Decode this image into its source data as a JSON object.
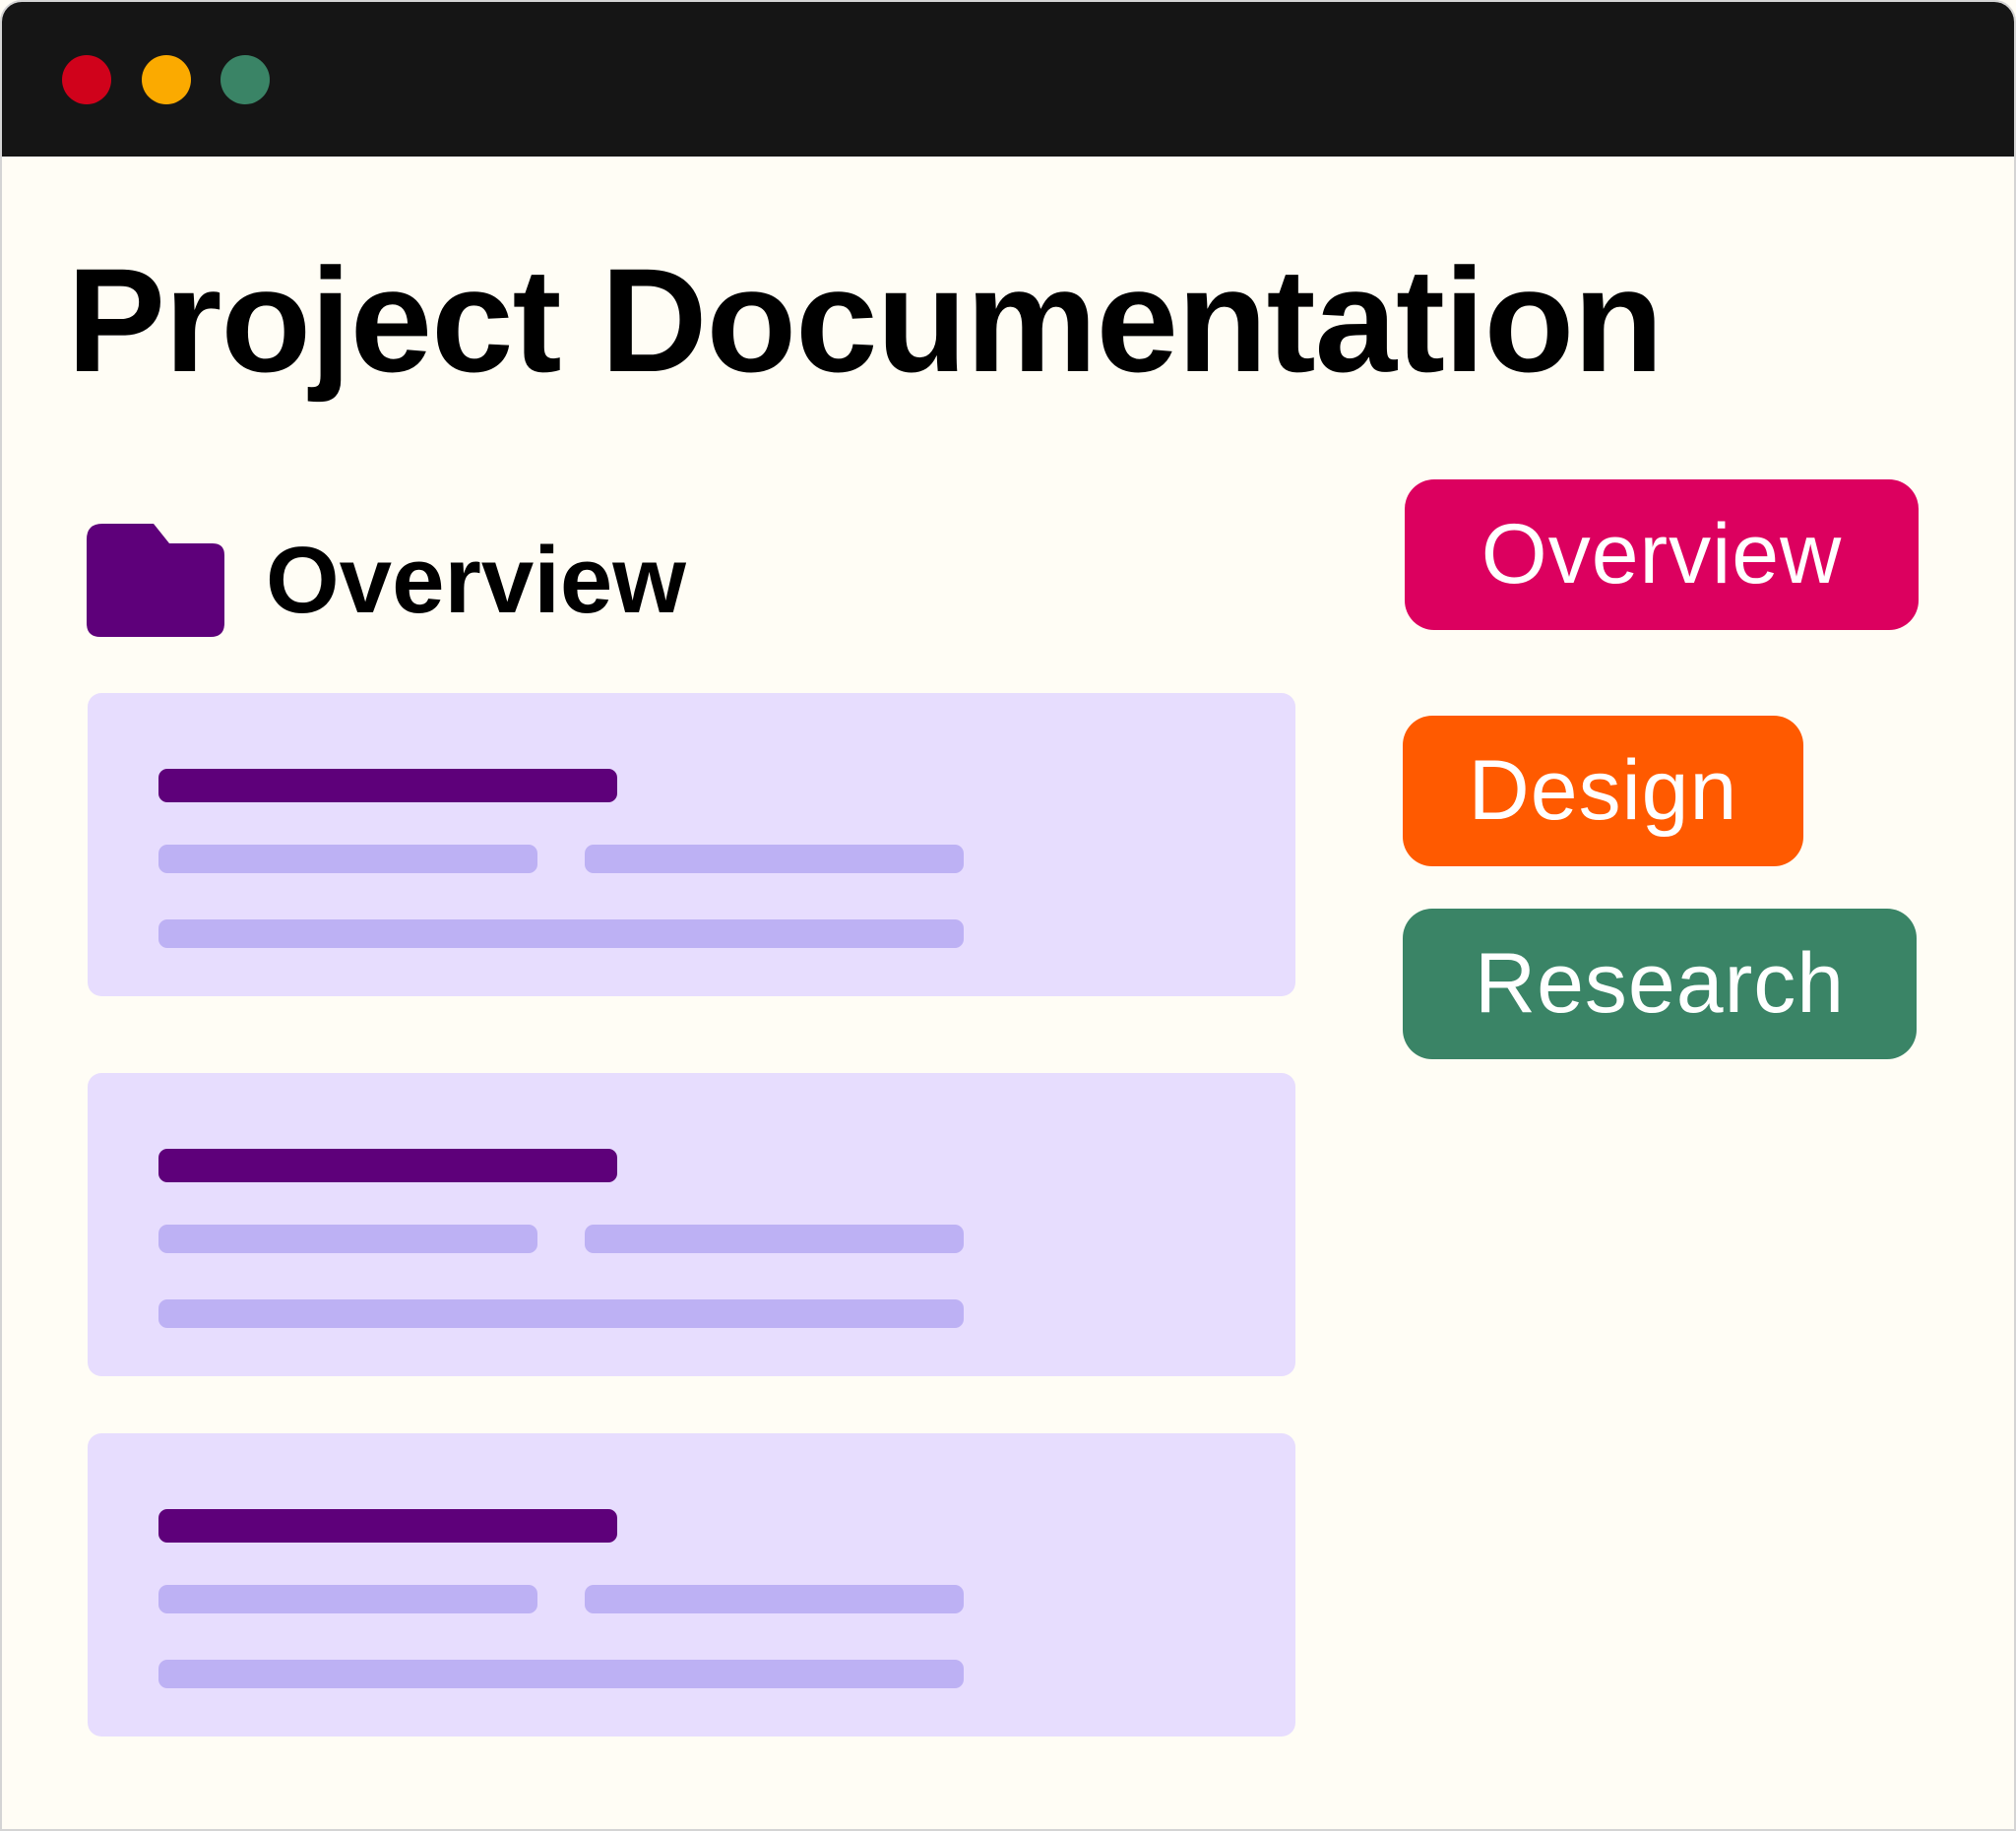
{
  "window": {
    "controls": [
      {
        "name": "close",
        "color": "#d0021b"
      },
      {
        "name": "minimize",
        "color": "#fbaa00"
      },
      {
        "name": "maximize",
        "color": "#3a8466"
      }
    ]
  },
  "page": {
    "title": "Project Documentation"
  },
  "section": {
    "icon": "folder-icon",
    "title": "Overview"
  },
  "cards": [
    {
      "type": "placeholder-document"
    },
    {
      "type": "placeholder-document"
    },
    {
      "type": "placeholder-document"
    }
  ],
  "tags": [
    {
      "label": "Overview",
      "color": "#dc005f"
    },
    {
      "label": "Design",
      "color": "#ff5a00"
    },
    {
      "label": "Research",
      "color": "#3a8466"
    }
  ],
  "colors": {
    "background": "#fffdf5",
    "titlebar": "#151515",
    "card": "#e7ddfe",
    "card_heading_bar": "#5e007a",
    "card_text_bar": "#bdb1f4",
    "folder": "#5e007a"
  }
}
